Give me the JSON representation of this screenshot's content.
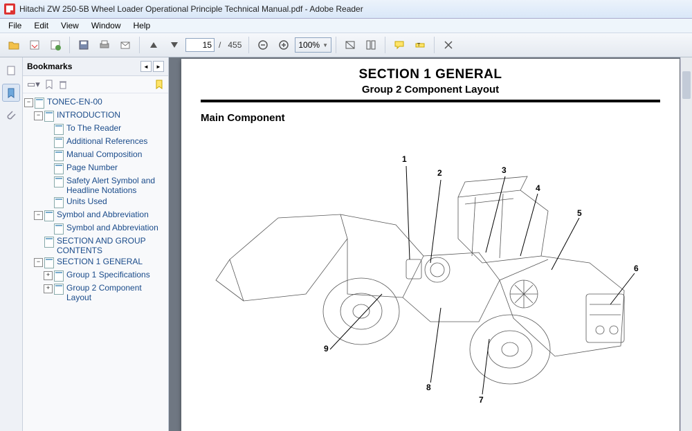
{
  "title": "Hitachi ZW 250-5B Wheel Loader Operational Principle Technical Manual.pdf - Adobe Reader",
  "menu": [
    "File",
    "Edit",
    "View",
    "Window",
    "Help"
  ],
  "toolbar": {
    "page_current": "15",
    "page_total": "455",
    "zoom": "100%"
  },
  "bookmarks": {
    "title": "Bookmarks"
  },
  "tree": {
    "root": "TONEC-EN-00",
    "intro": "INTRODUCTION",
    "intro_items": [
      "To The Reader",
      "Additional References",
      "Manual Composition",
      "Page Number",
      "Safety Alert Symbol and Headline Notations",
      "Units Used"
    ],
    "sym": "Symbol and Abbreviation",
    "sym_item": "Symbol and Abbreviation",
    "sgc": "SECTION AND GROUP CONTENTS",
    "s1": "SECTION 1 GENERAL",
    "s1g1": "Group 1 Specifications",
    "s1g2": "Group 2 Component Layout"
  },
  "doc": {
    "section_title": "SECTION 1 GENERAL",
    "section_sub": "Group 2 Component Layout",
    "heading": "Main Component",
    "callouts": [
      "1",
      "2",
      "3",
      "4",
      "5",
      "6",
      "7",
      "8",
      "9"
    ]
  },
  "page_of_sep": "/"
}
